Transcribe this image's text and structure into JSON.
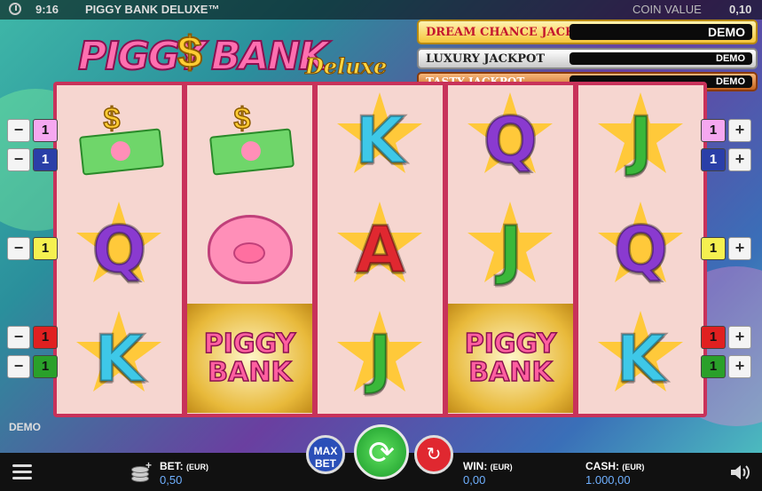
{
  "status_bar": {
    "time": "9:16",
    "game_title": "PIGGY BANK DELUXE™",
    "coin_value_label": "COIN VALUE",
    "coin_value": "0,10"
  },
  "logo": {
    "word1": "PIGGY",
    "symbol": "$",
    "word2": "BANK",
    "word3": "Deluxe"
  },
  "jackpots": [
    {
      "name": "DREAM CHANCE JACKPOT",
      "value": "DEMO"
    },
    {
      "name": "LUXURY JACKPOT",
      "value": "DEMO"
    },
    {
      "name": "TASTY JACKPOT",
      "value": "DEMO"
    }
  ],
  "reels": [
    [
      {
        "type": "money",
        "label": "$"
      },
      {
        "type": "letter",
        "label": "Q"
      },
      {
        "type": "letter",
        "label": "K"
      }
    ],
    [
      {
        "type": "money",
        "label": "$"
      },
      {
        "type": "pig",
        "label": ""
      },
      {
        "type": "piggybank",
        "label": "PIGGY BANK"
      }
    ],
    [
      {
        "type": "letter",
        "label": "K"
      },
      {
        "type": "letter",
        "label": "A"
      },
      {
        "type": "letter",
        "label": "J"
      }
    ],
    [
      {
        "type": "letter",
        "label": "Q"
      },
      {
        "type": "letter",
        "label": "J"
      },
      {
        "type": "piggybank",
        "label": "PIGGY BANK"
      }
    ],
    [
      {
        "type": "letter",
        "label": "J"
      },
      {
        "type": "letter",
        "label": "Q"
      },
      {
        "type": "letter",
        "label": "K"
      }
    ]
  ],
  "paylines_left": [
    {
      "minus": "−",
      "num": "1",
      "color": "#f5a8f0"
    },
    {
      "minus": "−",
      "num": "1",
      "color": "#2a3fa8"
    },
    {
      "minus": "−",
      "num": "1",
      "color": "#f5f050"
    },
    {
      "minus": "−",
      "num": "1",
      "color": "#e02020"
    },
    {
      "minus": "−",
      "num": "1",
      "color": "#2aa02a"
    }
  ],
  "paylines_right": [
    {
      "plus": "+",
      "num": "1",
      "color": "#f5a8f0"
    },
    {
      "plus": "+",
      "num": "1",
      "color": "#2a3fa8"
    },
    {
      "plus": "+",
      "num": "1",
      "color": "#f5f050"
    },
    {
      "plus": "+",
      "num": "1",
      "color": "#e02020"
    },
    {
      "plus": "+",
      "num": "1",
      "color": "#2aa02a"
    }
  ],
  "demo_label": "DEMO",
  "bottom": {
    "bet_label": "BET:",
    "bet_currency": "(EUR)",
    "bet_value": "0,50",
    "win_label": "WIN:",
    "win_currency": "(EUR)",
    "win_value": "0,00",
    "cash_label": "CASH:",
    "cash_currency": "(EUR)",
    "cash_value": "1.000,00",
    "max_bet_line1": "MAX",
    "max_bet_line2": "BET",
    "spin_glyph": "⟳",
    "autoplay_glyph": "↻"
  },
  "icons": [
    "clock-icon",
    "menu-icon",
    "coins-icon",
    "spin-icon",
    "autoplay-icon",
    "sound-icon"
  ]
}
